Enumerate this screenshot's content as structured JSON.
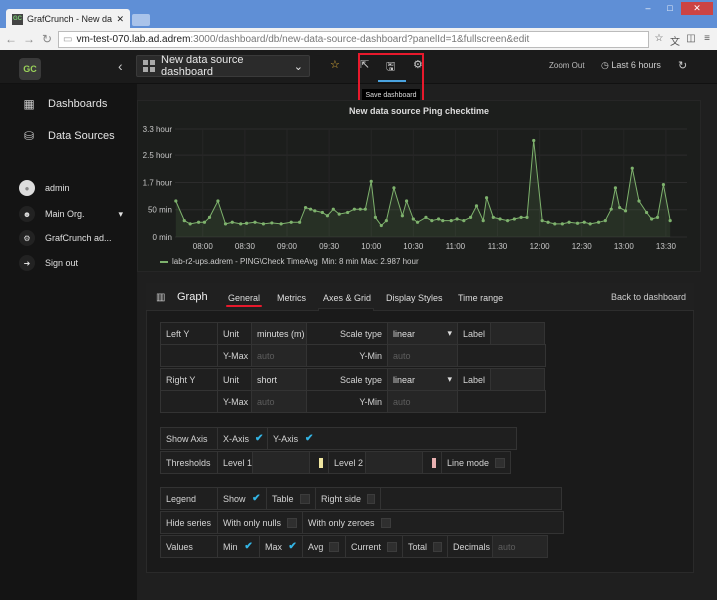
{
  "browser": {
    "tab_title": "GrafCrunch - New data sour",
    "favicon": "GC",
    "url_host": "vm-test-070.lab.ad.adrem",
    "url_path": ":3000/dashboard/db/new-data-source-dashboard?panelId=1&fullscreen&edit"
  },
  "topnav": {
    "logo": "GC",
    "dashboard_name": "New data source dashboard",
    "save_tooltip": "Save dashboard",
    "zoom_out": "Zoom Out",
    "time_range": "Last 6 hours"
  },
  "sidemenu": {
    "items": [
      {
        "label": "Dashboards",
        "icon": "grid-icon"
      },
      {
        "label": "Data Sources",
        "icon": "database-icon"
      }
    ],
    "user": "admin",
    "org": "Main Org.",
    "app": "GrafCrunch ad...",
    "signout": "Sign out"
  },
  "chart_data": {
    "type": "line",
    "title": "New data source Ping checktime",
    "ylim": [
      0,
      3.3
    ],
    "yticks": [
      "0 min",
      "50 min",
      "1.7 hour",
      "2.5 hour",
      "3.3 hour"
    ],
    "ytick_values": [
      0,
      0.833,
      1.667,
      2.5,
      3.3
    ],
    "xticks": [
      "08:00",
      "08:30",
      "09:00",
      "09:30",
      "10:00",
      "10:30",
      "11:00",
      "11:30",
      "12:00",
      "12:30",
      "13:00",
      "13:30"
    ],
    "xtick_values": [
      8.0,
      8.5,
      9.0,
      9.5,
      10.0,
      10.5,
      11.0,
      11.5,
      12.0,
      12.5,
      13.0,
      13.5
    ],
    "xlim": [
      7.67,
      13.75
    ],
    "series": [
      {
        "name": "lab-r2-ups.adrem - PING\\Check TimeAvg",
        "color": "#7eb26d",
        "x": [
          7.68,
          7.78,
          7.85,
          7.95,
          8.02,
          8.08,
          8.18,
          8.27,
          8.35,
          8.45,
          8.52,
          8.62,
          8.72,
          8.82,
          8.93,
          9.05,
          9.15,
          9.22,
          9.28,
          9.33,
          9.42,
          9.48,
          9.55,
          9.62,
          9.72,
          9.8,
          9.87,
          9.93,
          10.0,
          10.05,
          10.12,
          10.18,
          10.27,
          10.37,
          10.42,
          10.5,
          10.55,
          10.65,
          10.72,
          10.8,
          10.85,
          10.95,
          11.02,
          11.1,
          11.18,
          11.25,
          11.33,
          11.37,
          11.45,
          11.53,
          11.62,
          11.7,
          11.78,
          11.85,
          11.93,
          12.03,
          12.1,
          12.18,
          12.27,
          12.35,
          12.45,
          12.53,
          12.6,
          12.7,
          12.78,
          12.85,
          12.9,
          12.95,
          13.02,
          13.1,
          13.18,
          13.27,
          13.33,
          13.4,
          13.47,
          13.55
        ],
        "y": [
          1.1,
          0.5,
          0.4,
          0.45,
          0.45,
          0.6,
          1.1,
          0.4,
          0.45,
          0.4,
          0.42,
          0.45,
          0.4,
          0.43,
          0.4,
          0.45,
          0.45,
          0.9,
          0.85,
          0.8,
          0.75,
          0.65,
          0.85,
          0.7,
          0.75,
          0.85,
          0.85,
          0.85,
          1.7,
          0.6,
          0.35,
          0.5,
          1.5,
          0.65,
          1.1,
          0.55,
          0.45,
          0.6,
          0.5,
          0.55,
          0.5,
          0.5,
          0.55,
          0.5,
          0.6,
          0.95,
          0.5,
          1.2,
          0.6,
          0.55,
          0.5,
          0.55,
          0.6,
          0.6,
          2.95,
          0.5,
          0.45,
          0.4,
          0.4,
          0.45,
          0.42,
          0.45,
          0.4,
          0.45,
          0.5,
          0.85,
          1.5,
          0.9,
          0.8,
          2.1,
          1.1,
          0.75,
          0.55,
          0.6,
          1.6,
          0.5
        ]
      }
    ],
    "legend_stats": "Min: 8 min  Max: 2.987 hour"
  },
  "editor": {
    "title": "Graph",
    "tabs": [
      "General",
      "Metrics",
      "Axes & Grid",
      "Display Styles",
      "Time range"
    ],
    "back": "Back to dashboard",
    "left_y": {
      "label": "Left Y",
      "unit_label": "Unit",
      "unit": "minutes (m)",
      "scale_label": "Scale type",
      "scale": "linear",
      "label_label": "Label",
      "ymax_label": "Y-Max",
      "ymax_ph": "auto",
      "ymin_label": "Y-Min",
      "ymin_ph": "auto"
    },
    "right_y": {
      "label": "Right Y",
      "unit_label": "Unit",
      "unit": "short",
      "scale_label": "Scale type",
      "scale": "linear",
      "label_label": "Label",
      "ymax_label": "Y-Max",
      "ymax_ph": "auto",
      "ymin_label": "Y-Min",
      "ymin_ph": "auto"
    },
    "show_axis": {
      "label": "Show Axis",
      "x": "X-Axis",
      "y": "Y-Axis"
    },
    "thresholds": {
      "label": "Thresholds",
      "level1": "Level 1",
      "level2": "Level 2",
      "line_mode": "Line mode",
      "color1": "#f0e6a0",
      "color2": "#e8b0b0"
    },
    "legend": {
      "label": "Legend",
      "show": "Show",
      "table": "Table",
      "right_side": "Right side"
    },
    "hide_series": {
      "label": "Hide series",
      "nulls": "With only nulls",
      "zeroes": "With only zeroes"
    },
    "values": {
      "label": "Values",
      "min": "Min",
      "max": "Max",
      "avg": "Avg",
      "current": "Current",
      "total": "Total",
      "decimals": "Decimals",
      "decimals_ph": "auto"
    }
  }
}
